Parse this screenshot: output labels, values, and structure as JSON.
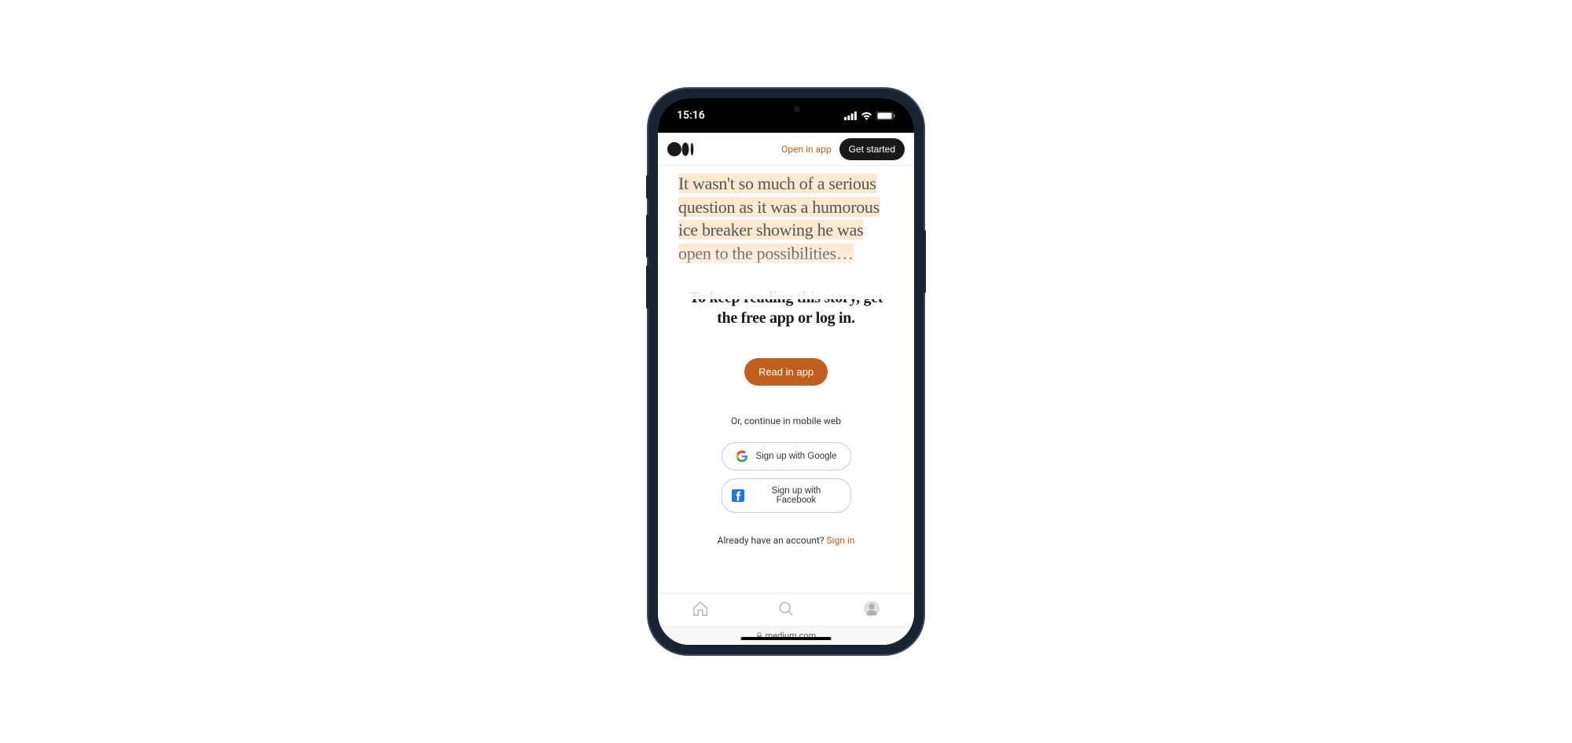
{
  "status_bar": {
    "time": "15:16"
  },
  "header": {
    "open_in_app_label": "Open in app",
    "get_started_label": "Get started"
  },
  "article": {
    "preview_text": "It wasn't so much of a serious question as it was a humorous ice breaker showing he was open to the possibilities…"
  },
  "paywall": {
    "heading": "To keep reading this story, get the free app or log in.",
    "read_in_app_label": "Read in app",
    "continue_label": "Or, continue in mobile web",
    "google_label": "Sign up with Google",
    "facebook_label": "Sign up with Facebook",
    "existing_account_label": "Already have an account? ",
    "signin_label": "Sign in"
  },
  "browser": {
    "url": "medium.com"
  }
}
